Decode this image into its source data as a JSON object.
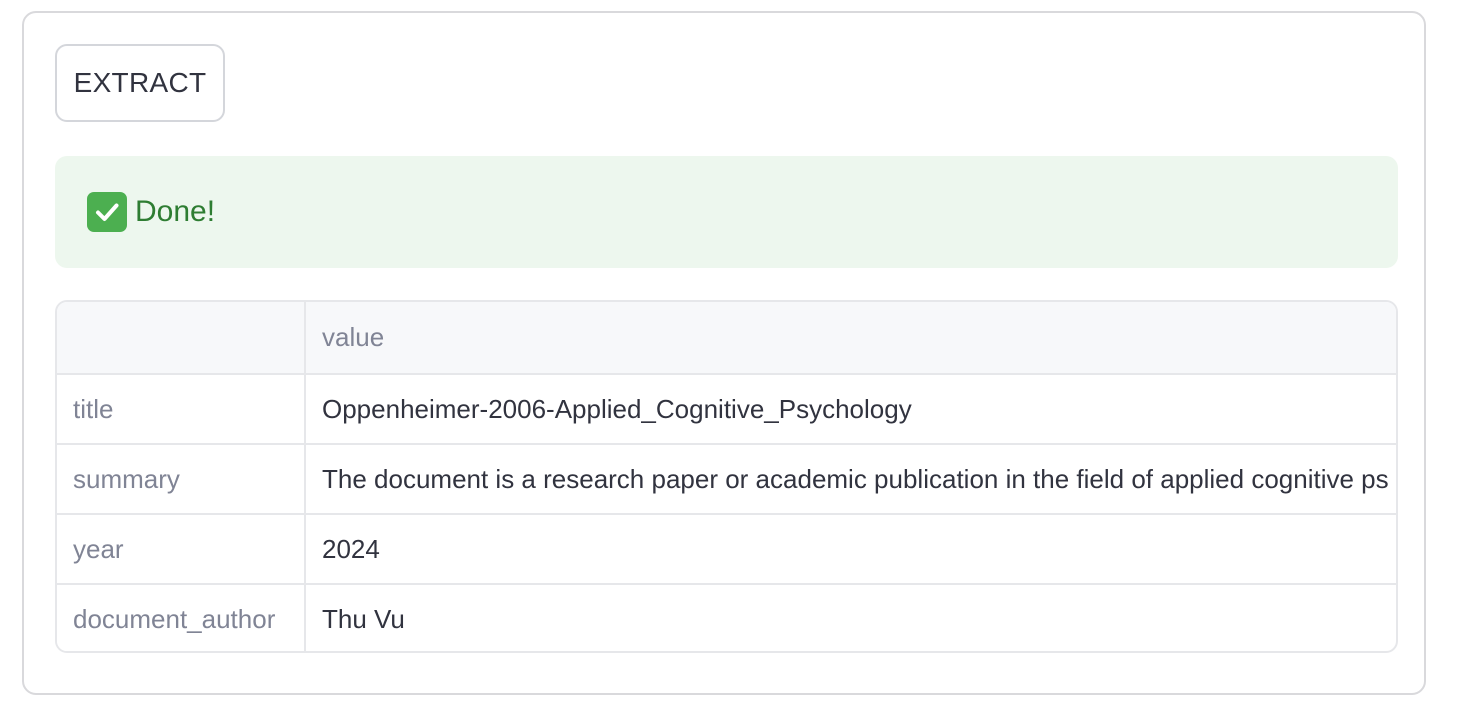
{
  "extract_button": {
    "label": "EXTRACT"
  },
  "status": {
    "icon": "check-mark-icon",
    "text": "Done!",
    "color": "#2e7d32",
    "background": "#edf7ee"
  },
  "table": {
    "columns": [
      "",
      "value"
    ],
    "rows": [
      {
        "key": "title",
        "value": "Oppenheimer-2006-Applied_Cognitive_Psychology"
      },
      {
        "key": "summary",
        "value": "The document is a research paper or academic publication in the field of applied cognitive ps"
      },
      {
        "key": "year",
        "value": "2024"
      },
      {
        "key": "document_author",
        "value": "Thu Vu"
      }
    ]
  }
}
